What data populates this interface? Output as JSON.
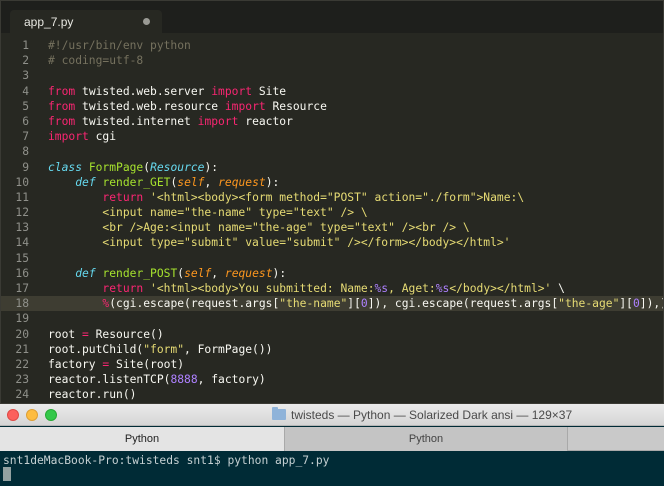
{
  "editor": {
    "tab_title": "app_7.py",
    "active_line": 18,
    "lines": [
      [
        [
          "c",
          "#!/usr/bin/env python"
        ]
      ],
      [
        [
          "c",
          "# coding=utf-8"
        ]
      ],
      [],
      [
        [
          "k",
          "from"
        ],
        [
          "t",
          " twisted.web.server "
        ],
        [
          "k",
          "import"
        ],
        [
          "t",
          " Site"
        ]
      ],
      [
        [
          "k",
          "from"
        ],
        [
          "t",
          " twisted.web.resource "
        ],
        [
          "k",
          "import"
        ],
        [
          "t",
          " Resource"
        ]
      ],
      [
        [
          "k",
          "from"
        ],
        [
          "t",
          " twisted.internet "
        ],
        [
          "k",
          "import"
        ],
        [
          "t",
          " reactor"
        ]
      ],
      [
        [
          "k",
          "import"
        ],
        [
          "t",
          " cgi"
        ]
      ],
      [],
      [
        [
          "d",
          "class"
        ],
        [
          "t",
          " "
        ],
        [
          "f",
          "FormPage"
        ],
        [
          "t",
          "("
        ],
        [
          "i",
          "Resource"
        ],
        [
          "t",
          "):"
        ]
      ],
      [
        [
          "t",
          "    "
        ],
        [
          "d",
          "def"
        ],
        [
          "t",
          " "
        ],
        [
          "f",
          "render_GET"
        ],
        [
          "t",
          "("
        ],
        [
          "p",
          "self"
        ],
        [
          "t",
          ", "
        ],
        [
          "p",
          "request"
        ],
        [
          "t",
          "):"
        ]
      ],
      [
        [
          "t",
          "        "
        ],
        [
          "k",
          "return"
        ],
        [
          "t",
          " "
        ],
        [
          "s",
          "'<html><body><form method=\"POST\" action=\"./form\">Name:\\"
        ]
      ],
      [
        [
          "s",
          "        <input name=\"the-name\" type=\"text\" /> \\"
        ]
      ],
      [
        [
          "s",
          "        <br />Age:<input name=\"the-age\" type=\"text\" /><br /> \\"
        ]
      ],
      [
        [
          "s",
          "        <input type=\"submit\" value=\"submit\" /></form></body></html>'"
        ]
      ],
      [],
      [
        [
          "t",
          "    "
        ],
        [
          "d",
          "def"
        ],
        [
          "t",
          " "
        ],
        [
          "f",
          "render_POST"
        ],
        [
          "t",
          "("
        ],
        [
          "p",
          "self"
        ],
        [
          "t",
          ", "
        ],
        [
          "p",
          "request"
        ],
        [
          "t",
          "):"
        ]
      ],
      [
        [
          "t",
          "        "
        ],
        [
          "k",
          "return"
        ],
        [
          "t",
          " "
        ],
        [
          "s",
          "'<html><body>You submitted: Name:"
        ],
        [
          "n",
          "%s"
        ],
        [
          "s",
          ", Aget:"
        ],
        [
          "n",
          "%s"
        ],
        [
          "s",
          "</body></html>'"
        ],
        [
          "t",
          " \\"
        ]
      ],
      [
        [
          "t",
          "        "
        ],
        [
          "k",
          "%"
        ],
        [
          "t",
          "(cgi.escape(request.args["
        ],
        [
          "s",
          "\"the-name\""
        ],
        [
          "t",
          "]["
        ],
        [
          "n",
          "0"
        ],
        [
          "t",
          "]), cgi.escape(request.args["
        ],
        [
          "s",
          "\"the-age\""
        ],
        [
          "t",
          "]["
        ],
        [
          "n",
          "0"
        ],
        [
          "t",
          "]),)"
        ]
      ],
      [],
      [
        [
          "t",
          "root "
        ],
        [
          "k",
          "="
        ],
        [
          "t",
          " Resource()"
        ]
      ],
      [
        [
          "t",
          "root.putChild("
        ],
        [
          "s",
          "\"form\""
        ],
        [
          "t",
          ", FormPage())"
        ]
      ],
      [
        [
          "t",
          "factory "
        ],
        [
          "k",
          "="
        ],
        [
          "t",
          " Site(root)"
        ]
      ],
      [
        [
          "t",
          "reactor.listenTCP("
        ],
        [
          "n",
          "8888"
        ],
        [
          "t",
          ", factory)"
        ]
      ],
      [
        [
          "t",
          "reactor.run()"
        ]
      ],
      []
    ]
  },
  "terminal": {
    "window_title": "twisteds — Python — Solarized Dark ansi — 129×37",
    "tabs": [
      "Python",
      "Python"
    ],
    "prompt_line": "snt1deMacBook-Pro:twisteds snt1$ python app_7.py"
  },
  "colors": {
    "editor_bg": "#272822",
    "keyword": "#f92672",
    "comment": "#75715e",
    "string": "#e6db74",
    "function": "#a6e22e",
    "terminal_bg": "#002b36"
  }
}
